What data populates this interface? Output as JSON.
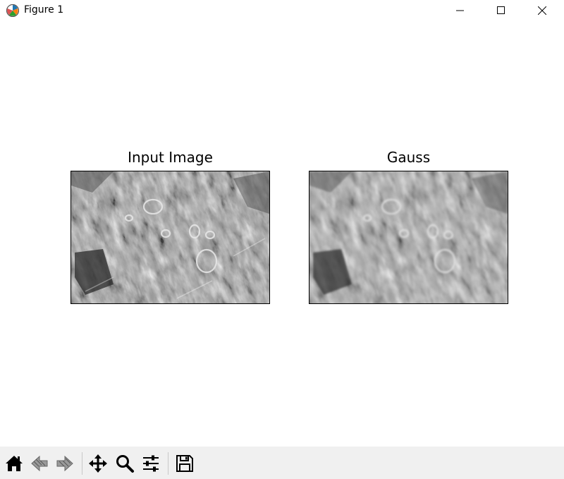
{
  "window": {
    "title": "Figure 1",
    "app_icon": "matplotlib-icon",
    "controls": [
      "minimize-icon",
      "maximize-icon",
      "close-icon"
    ]
  },
  "figure": {
    "subplots": [
      {
        "title": "Input Image",
        "content": "grayscale-photo"
      },
      {
        "title": "Gauss",
        "content": "gaussian-blurred-grayscale-photo"
      }
    ]
  },
  "toolbar": {
    "buttons": [
      "home-icon",
      "back-icon",
      "forward-icon",
      "pan-icon",
      "zoom-icon",
      "configure-subplots-icon",
      "save-icon"
    ]
  }
}
